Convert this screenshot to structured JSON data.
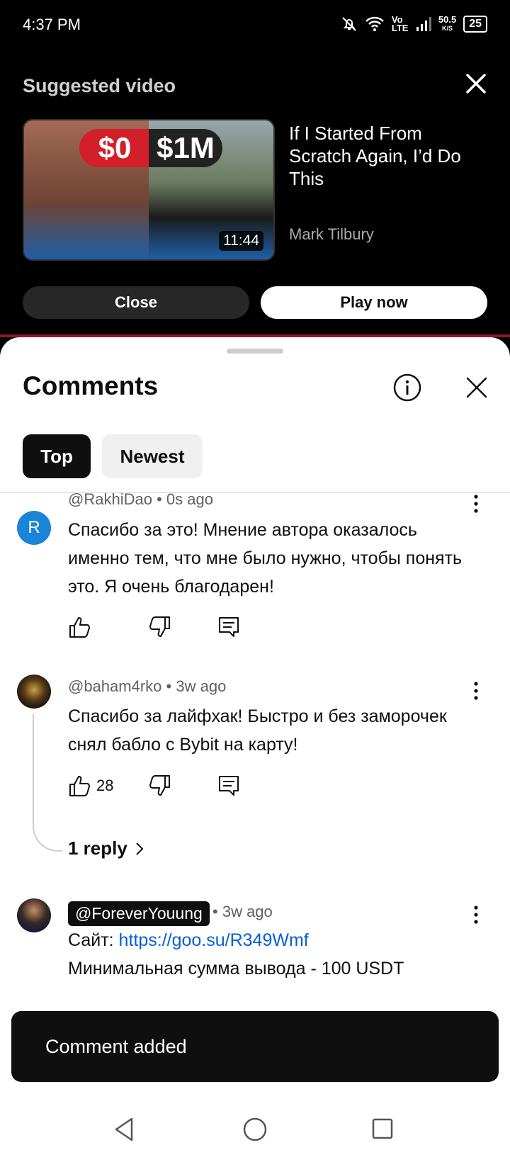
{
  "status_bar": {
    "time": "4:37 PM",
    "network_type": "Vo LTE",
    "speed_value": "50.5",
    "speed_unit": "K/S",
    "battery": "25"
  },
  "suggested_video": {
    "heading": "Suggested video",
    "thumbnail": {
      "badge_left": "$0",
      "badge_right": "$1M",
      "duration": "11:44"
    },
    "title": "If I Started From Scratch Again, I’d Do This",
    "channel": "Mark Tilbury",
    "close_label": "Close",
    "play_label": "Play now"
  },
  "comments": {
    "title": "Comments",
    "tabs": [
      {
        "label": "Top",
        "active": true
      },
      {
        "label": "Newest",
        "active": false
      }
    ],
    "items": [
      {
        "avatar_letter": "R",
        "author": "@RakhiDao",
        "age": "0s ago",
        "text": "Спасибо за это! Мнение автора оказалось именно тем, что мне было нужно, чтобы понять это. Я очень благодарен!"
      },
      {
        "author": "@baham4rko",
        "age": "3w ago",
        "text": "Спасибо за лайфхак! Быстро и без заморочек снял бабло с Bybit на карту!",
        "likes": "28",
        "reply_label": "1 reply"
      },
      {
        "author": "@ForeverYouung",
        "age": "3w ago",
        "site_label": "Сайт: ",
        "site_link": "https://goo.su/R349Wmf",
        "text_partial": "Минимальная сумма вывода - 100 USDT"
      }
    ]
  },
  "snackbar": {
    "message": "Comment added"
  },
  "colors": {
    "brand_red": "#d21f2a",
    "link_blue": "#065fd4",
    "avatar_blue": "#1a84d8"
  }
}
